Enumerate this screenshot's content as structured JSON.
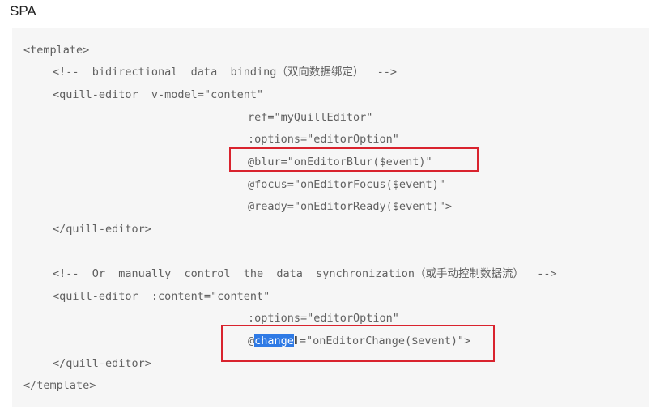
{
  "heading": "SPA",
  "code": {
    "l1": "<template>",
    "l2": "<!--  bidirectional  data  binding（双向数据绑定）  -->",
    "l3": "<quill-editor  v-model=\"content\"",
    "l4": "ref=\"myQuillEditor\"",
    "l5": ":options=\"editorOption\"",
    "l6": "@blur=\"onEditorBlur($event)\"",
    "l7": "@focus=\"onEditorFocus($event)\"",
    "l8": "@ready=\"onEditorReady($event)\">",
    "l9": "</quill-editor>",
    "l10": "<!--  Or  manually  control  the  data  synchronization（或手动控制数据流）  -->",
    "l11": "<quill-editor  :content=\"content\"",
    "l12": ":options=\"editorOption\"",
    "l13_prefix": "@",
    "l13_selected": "change",
    "l13_rest": "=\"onEditorChange($event)\">",
    "l14": "</quill-editor>",
    "l15": "</template>"
  },
  "cursor_glyph": "I",
  "colors": {
    "highlight_border": "#d9232e",
    "selection": "#2f7ae5",
    "code_background": "#f6f6f6"
  }
}
